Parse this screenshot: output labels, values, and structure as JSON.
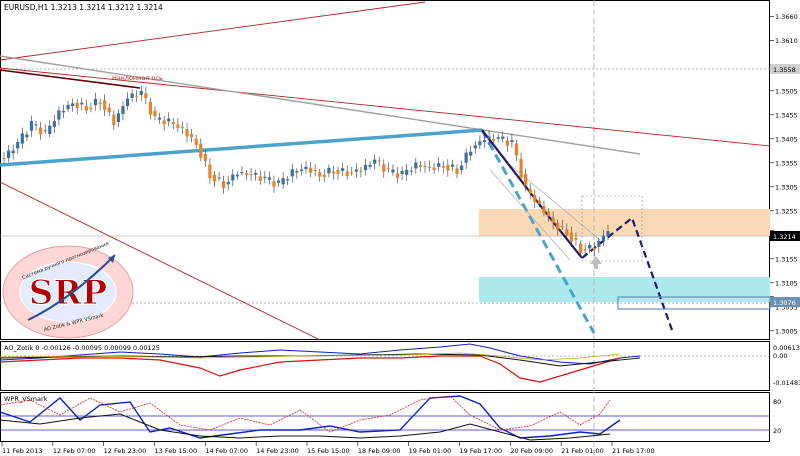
{
  "window": {
    "symbol_header": "EURUSD,H1  1.3213 1.3214 1.3212 1.3214",
    "annotation_label": "Наклонная ось"
  },
  "logo": {
    "text": "SRP",
    "arc_top": "Система ручного прогнозирования",
    "arc_bottom": "AO Zotik & WPR VSmark"
  },
  "price_axis": {
    "ticks": [
      "1.3660",
      "1.3610",
      "1.3558",
      "1.3505",
      "1.3455",
      "1.3405",
      "1.3355",
      "1.3305",
      "1.3255",
      "1.3214",
      "1.3155",
      "1.3105",
      "1.3076",
      "1.3055",
      "1.3005"
    ],
    "current_price": "1.3214",
    "marked_price": "1.3558",
    "box_price": "1.3076"
  },
  "indicator_ao": {
    "title": "AO_Zotik  0 -0.00126 -0.00095 0.00099 0.00125",
    "ticks": [
      "0.00613",
      "0.00",
      "-0.01483"
    ]
  },
  "indicator_wpr": {
    "title": "WPR_VSmark",
    "ticks": [
      "80",
      "20"
    ]
  },
  "time_axis": [
    "11 Feb 2013",
    "12 Feb 07:00",
    "12 Feb 23:00",
    "13 Feb 15:00",
    "14 Feb 07:00",
    "14 Feb 23:00",
    "15 Feb 15:00",
    "18 Feb 09:00",
    "19 Feb 01:00",
    "19 Feb 17:00",
    "20 Feb 09:00",
    "21 Feb 01:00",
    "21 Feb 17:00"
  ],
  "colors": {
    "bull": "#3a6ea5",
    "bear": "#e8832a",
    "trend_blue": "#4aa3c9",
    "dark_red": "#8b0000",
    "navy": "#1a1a6e",
    "orange_zone": "#fbd9b4",
    "cyan_zone": "#aee9f0"
  },
  "chart_data": {
    "type": "candlestick",
    "symbol": "EURUSD",
    "timeframe": "H1",
    "ohlc_header": [
      1.3213,
      1.3214,
      1.3212,
      1.3214
    ],
    "close_path": [
      1.3365,
      1.3395,
      1.3435,
      1.3415,
      1.346,
      1.348,
      1.347,
      1.3485,
      1.344,
      1.349,
      1.35,
      1.3445,
      1.344,
      1.3425,
      1.3395,
      1.333,
      1.331,
      1.3335,
      1.333,
      1.332,
      1.331,
      1.3335,
      1.3345,
      1.333,
      1.334,
      1.3335,
      1.334,
      1.336,
      1.3335,
      1.333,
      1.335,
      1.3345,
      1.335,
      1.334,
      1.3385,
      1.3405,
      1.3405,
      1.3395,
      1.33,
      1.3265,
      1.323,
      1.321,
      1.3175,
      1.318,
      1.3214
    ],
    "zones": [
      {
        "name": "resistance",
        "from": 1.3214,
        "to": 1.3268
      },
      {
        "name": "support",
        "from": 1.3078,
        "to": 1.314
      }
    ],
    "ylim": [
      1.299,
      1.369
    ]
  }
}
